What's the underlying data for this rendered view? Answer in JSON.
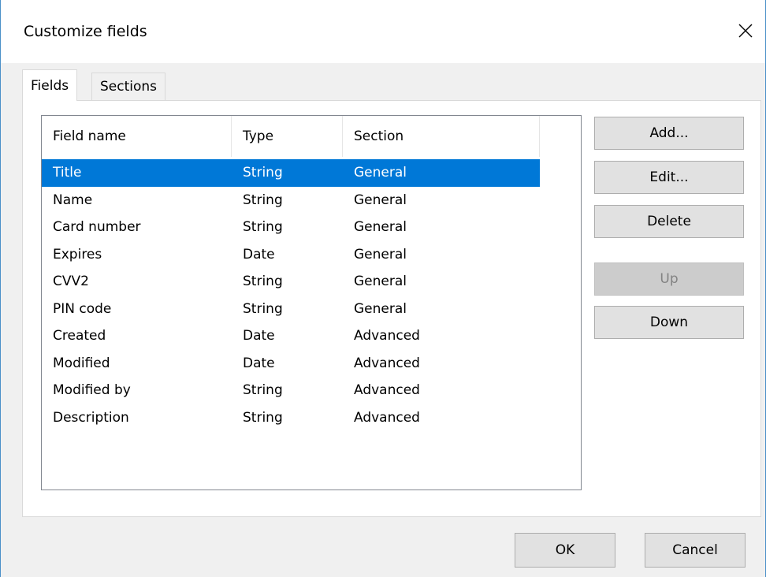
{
  "dialog": {
    "title": "Customize fields"
  },
  "icons": {
    "close": "close-icon"
  },
  "tabs": [
    {
      "label": "Fields",
      "active": true
    },
    {
      "label": "Sections",
      "active": false
    }
  ],
  "fields_list": {
    "columns": [
      "Field name",
      "Type",
      "Section"
    ],
    "rows": [
      {
        "name": "Title",
        "type": "String",
        "section": "General",
        "selected": true
      },
      {
        "name": "Name",
        "type": "String",
        "section": "General"
      },
      {
        "name": "Card number",
        "type": "String",
        "section": "General"
      },
      {
        "name": "Expires",
        "type": "Date",
        "section": "General"
      },
      {
        "name": "CVV2",
        "type": "String",
        "section": "General"
      },
      {
        "name": "PIN code",
        "type": "String",
        "section": "General"
      },
      {
        "name": "Created",
        "type": "Date",
        "section": "Advanced"
      },
      {
        "name": "Modified",
        "type": "Date",
        "section": "Advanced"
      },
      {
        "name": "Modified by",
        "type": "String",
        "section": "Advanced"
      },
      {
        "name": "Description",
        "type": "String",
        "section": "Advanced"
      }
    ]
  },
  "side_buttons": {
    "add": "Add...",
    "edit": "Edit...",
    "delete": "Delete",
    "up": "Up",
    "down": "Down"
  },
  "footer": {
    "ok": "OK",
    "cancel": "Cancel"
  },
  "colors": {
    "selection": "#0078d7",
    "dialog_bg": "#f0f0f0",
    "button_bg": "#e1e1e1",
    "disabled_button_bg": "#cccccc"
  }
}
